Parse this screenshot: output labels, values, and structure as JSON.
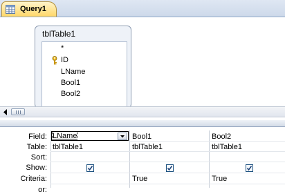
{
  "tab": {
    "label": "Query1",
    "icon": "query-icon"
  },
  "table_box": {
    "title": "tblTable1",
    "fields": [
      {
        "name": "*",
        "key": false
      },
      {
        "name": "ID",
        "key": true
      },
      {
        "name": "LName",
        "key": false
      },
      {
        "name": "Bool1",
        "key": false
      },
      {
        "name": "Bool2",
        "key": false
      }
    ]
  },
  "grid": {
    "row_labels": [
      "Field:",
      "Table:",
      "Sort:",
      "Show:",
      "Criteria:",
      "or:"
    ],
    "columns": [
      {
        "field": "LName",
        "table": "tblTable1",
        "sort": "",
        "show": true,
        "criteria": ""
      },
      {
        "field": "Bool1",
        "table": "tblTable1",
        "sort": "",
        "show": true,
        "criteria": "True"
      },
      {
        "field": "Bool2",
        "table": "tblTable1",
        "sort": "",
        "show": true,
        "criteria": "True"
      }
    ]
  }
}
